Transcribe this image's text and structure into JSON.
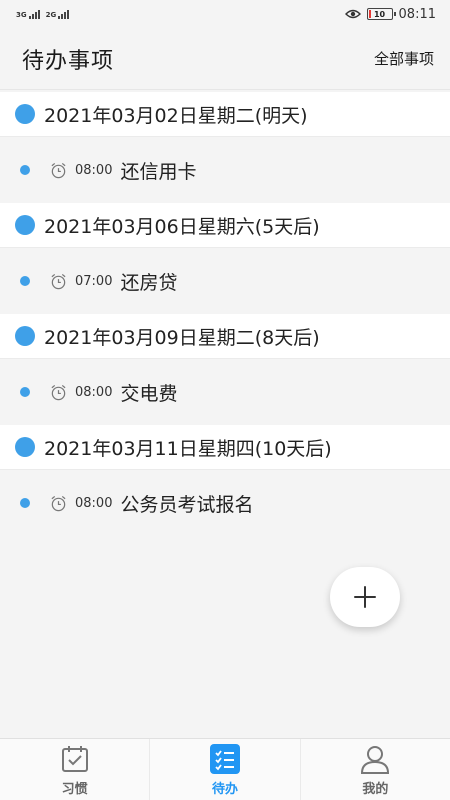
{
  "status_bar": {
    "network1": "3G",
    "network2": "2G",
    "battery_level": 0.1,
    "battery_text": "10",
    "time": "08:11"
  },
  "header": {
    "title": "待办事项",
    "all_items_label": "全部事项"
  },
  "timeline": [
    {
      "date": "2021年03月02日星期二(明天)",
      "items": [
        {
          "time": "08:00",
          "title": "还信用卡"
        }
      ]
    },
    {
      "date": "2021年03月06日星期六(5天后)",
      "items": [
        {
          "time": "07:00",
          "title": "还房贷"
        }
      ]
    },
    {
      "date": "2021年03月09日星期二(8天后)",
      "items": [
        {
          "time": "08:00",
          "title": "交电费"
        }
      ]
    },
    {
      "date": "2021年03月11日星期四(10天后)",
      "items": [
        {
          "time": "08:00",
          "title": "公务员考试报名"
        }
      ]
    }
  ],
  "fab": {
    "icon": "plus-icon"
  },
  "bottom_nav": [
    {
      "label": "习惯",
      "icon": "calendar-check-icon",
      "active": false
    },
    {
      "label": "待办",
      "icon": "checklist-icon",
      "active": true
    },
    {
      "label": "我的",
      "icon": "user-icon",
      "active": false
    }
  ],
  "colors": {
    "accent": "#3fa0e8",
    "nav_active": "#2196f3",
    "battery_low": "#e53935"
  }
}
